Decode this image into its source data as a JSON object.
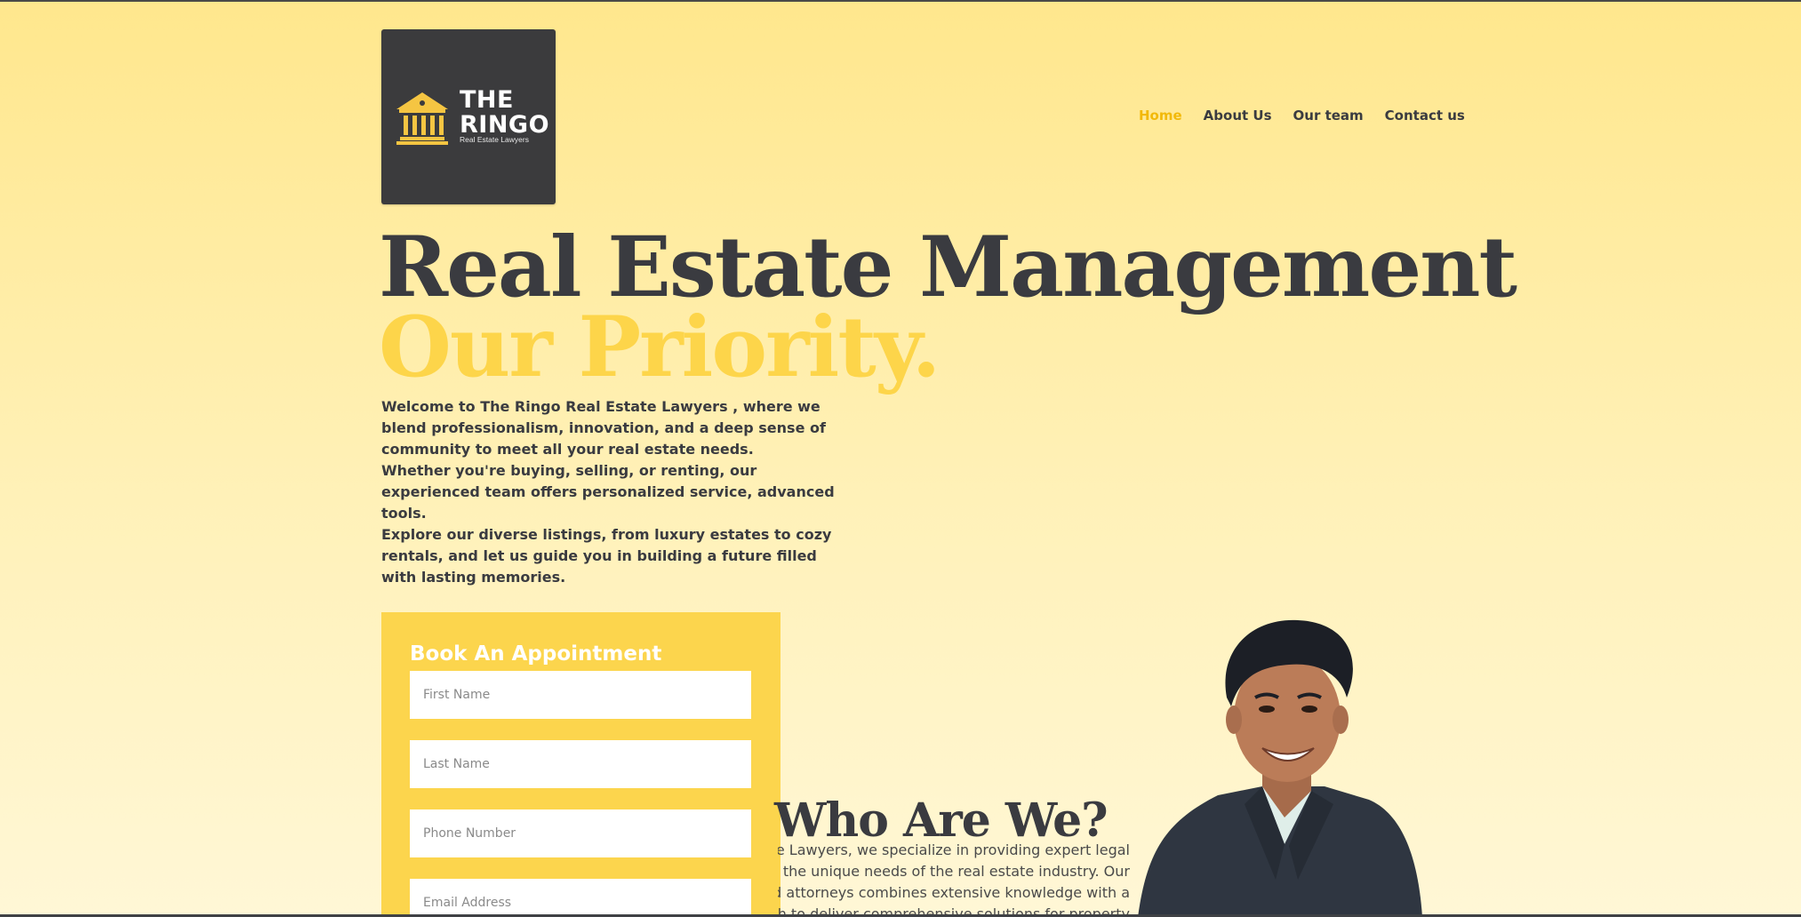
{
  "brand": {
    "logo_top": "THE",
    "logo_bottom": "RINGO",
    "logo_subtitle": "Real Estate Lawyers",
    "logo_icon": "courthouse-icon"
  },
  "nav": {
    "items": [
      "Home",
      "About Us",
      "Our team",
      "Contact us"
    ],
    "active": "Home"
  },
  "hero": {
    "title_line1": "Real Estate Management",
    "title_line2": "Our Priority.",
    "paragraphs": [
      "Welcome to The Ringo Real Estate Lawyers , where we blend professionalism, innovation, and a deep sense of community to meet all your real estate needs.",
      "Whether you're buying, selling, or renting, our experienced team offers personalized service, advanced tools.",
      "Explore our diverse listings, from luxury estates to cozy rentals, and let us guide you in building a future filled with lasting memories."
    ]
  },
  "appointment": {
    "heading": "Book An Appointment",
    "fields": [
      {
        "placeholder": "First Name",
        "value": ""
      },
      {
        "placeholder": "Last Name",
        "value": ""
      },
      {
        "placeholder": "Phone Number",
        "value": ""
      },
      {
        "placeholder": "Email Address",
        "value": ""
      }
    ]
  },
  "about": {
    "heading": "Who Are We?",
    "text_lines": [
      "state Lawyers, we specialize in providing expert legal",
      "d to the unique needs of the real estate industry. Our",
      "ned attorneys combines extensive knowledge with a",
      "proach to deliver comprehensive solutions for property"
    ]
  },
  "colors": {
    "accent": "#fcd54d",
    "nav_active": "#f2b90a",
    "text_dark": "#3a3b40",
    "logo_bg": "#3b3b3d"
  }
}
